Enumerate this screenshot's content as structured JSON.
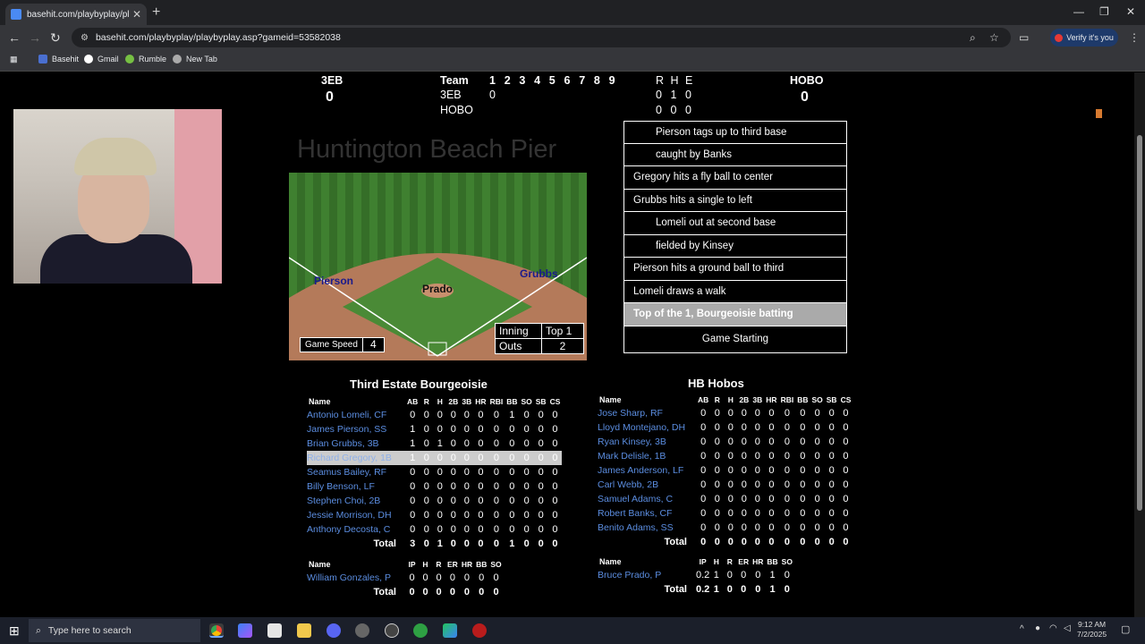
{
  "browser": {
    "tab_title": "basehit.com/playbyplay/playbyp",
    "url": "basehit.com/playbyplay/playbyplay.asp?gameid=53582038",
    "verify_label": "Verify it's you",
    "bookmarks": [
      "Basehit",
      "Gmail",
      "Rumble",
      "New Tab"
    ]
  },
  "scoreboard": {
    "away_abbr": "3EB",
    "away_score": "0",
    "home_abbr": "HOBO",
    "home_score": "0",
    "team_header": "Team",
    "innings": [
      "1",
      "2",
      "3",
      "4",
      "5",
      "6",
      "7",
      "8",
      "9"
    ],
    "rhe_header": [
      "R",
      "H",
      "E"
    ],
    "away_line": {
      "team": "3EB",
      "innings": [
        "0",
        "",
        "",
        "",
        "",
        "",
        "",
        "",
        ""
      ],
      "rhe": [
        "0",
        "1",
        "0"
      ]
    },
    "home_line": {
      "team": "HOBO",
      "innings": [
        "",
        "",
        "",
        "",
        "",
        "",
        "",
        "",
        ""
      ],
      "rhe": [
        "0",
        "0",
        "0"
      ]
    }
  },
  "stadium": "Huntington Beach Pier",
  "field": {
    "players": {
      "left": "Pierson",
      "pitcher": "Prado",
      "right": "Grubbs"
    },
    "game_speed_label": "Game Speed",
    "game_speed_value": "4",
    "inning_label": "Inning",
    "inning_value": "Top 1",
    "outs_label": "Outs",
    "outs_value": "2"
  },
  "play_by_play": [
    {
      "text": "Pierson tags up to third base",
      "style": "indent"
    },
    {
      "text": "caught by Banks",
      "style": "indent"
    },
    {
      "text": "Gregory hits a fly ball to center",
      "style": ""
    },
    {
      "text": "Grubbs hits a single to left",
      "style": ""
    },
    {
      "text": "Lomeli out at second base",
      "style": "indent"
    },
    {
      "text": "fielded by Kinsey",
      "style": "indent"
    },
    {
      "text": "Pierson hits a ground ball to third",
      "style": ""
    },
    {
      "text": "Lomeli draws a walk",
      "style": ""
    },
    {
      "text": "Top of the 1, Bourgeoisie batting",
      "style": "hl"
    },
    {
      "text": "Game Starting",
      "style": "center"
    }
  ],
  "away_box": {
    "title": "Third Estate Bourgeoisie",
    "headers": [
      "Name",
      "AB",
      "R",
      "H",
      "2B",
      "3B",
      "HR",
      "RBI",
      "BB",
      "SO",
      "SB",
      "CS"
    ],
    "rows": [
      [
        "Antonio Lomeli, CF",
        "0",
        "0",
        "0",
        "0",
        "0",
        "0",
        "0",
        "1",
        "0",
        "0",
        "0"
      ],
      [
        "James Pierson, SS",
        "1",
        "0",
        "0",
        "0",
        "0",
        "0",
        "0",
        "0",
        "0",
        "0",
        "0"
      ],
      [
        "Brian Grubbs, 3B",
        "1",
        "0",
        "1",
        "0",
        "0",
        "0",
        "0",
        "0",
        "0",
        "0",
        "0"
      ],
      [
        "Richard Gregory, 1B",
        "1",
        "0",
        "0",
        "0",
        "0",
        "0",
        "0",
        "0",
        "0",
        "0",
        "0"
      ],
      [
        "Seamus Bailey, RF",
        "0",
        "0",
        "0",
        "0",
        "0",
        "0",
        "0",
        "0",
        "0",
        "0",
        "0"
      ],
      [
        "Billy Benson, LF",
        "0",
        "0",
        "0",
        "0",
        "0",
        "0",
        "0",
        "0",
        "0",
        "0",
        "0"
      ],
      [
        "Stephen Choi, 2B",
        "0",
        "0",
        "0",
        "0",
        "0",
        "0",
        "0",
        "0",
        "0",
        "0",
        "0"
      ],
      [
        "Jessie Morrison, DH",
        "0",
        "0",
        "0",
        "0",
        "0",
        "0",
        "0",
        "0",
        "0",
        "0",
        "0"
      ],
      [
        "Anthony Decosta, C",
        "0",
        "0",
        "0",
        "0",
        "0",
        "0",
        "0",
        "0",
        "0",
        "0",
        "0"
      ]
    ],
    "selected_row": 3,
    "total": [
      "Total",
      "3",
      "0",
      "1",
      "0",
      "0",
      "0",
      "0",
      "1",
      "0",
      "0",
      "0"
    ],
    "pitch_headers": [
      "Name",
      "IP",
      "H",
      "R",
      "ER",
      "HR",
      "BB",
      "SO"
    ],
    "pitch_rows": [
      [
        "William Gonzales, P",
        "0",
        "0",
        "0",
        "0",
        "0",
        "0",
        "0"
      ]
    ],
    "pitch_total": [
      "Total",
      "0",
      "0",
      "0",
      "0",
      "0",
      "0",
      "0"
    ]
  },
  "home_box": {
    "title": "HB Hobos",
    "headers": [
      "Name",
      "AB",
      "R",
      "H",
      "2B",
      "3B",
      "HR",
      "RBI",
      "BB",
      "SO",
      "SB",
      "CS"
    ],
    "rows": [
      [
        "Jose Sharp, RF",
        "0",
        "0",
        "0",
        "0",
        "0",
        "0",
        "0",
        "0",
        "0",
        "0",
        "0"
      ],
      [
        "Lloyd Montejano, DH",
        "0",
        "0",
        "0",
        "0",
        "0",
        "0",
        "0",
        "0",
        "0",
        "0",
        "0"
      ],
      [
        "Ryan Kinsey, 3B",
        "0",
        "0",
        "0",
        "0",
        "0",
        "0",
        "0",
        "0",
        "0",
        "0",
        "0"
      ],
      [
        "Mark Delisle, 1B",
        "0",
        "0",
        "0",
        "0",
        "0",
        "0",
        "0",
        "0",
        "0",
        "0",
        "0"
      ],
      [
        "James Anderson, LF",
        "0",
        "0",
        "0",
        "0",
        "0",
        "0",
        "0",
        "0",
        "0",
        "0",
        "0"
      ],
      [
        "Carl Webb, 2B",
        "0",
        "0",
        "0",
        "0",
        "0",
        "0",
        "0",
        "0",
        "0",
        "0",
        "0"
      ],
      [
        "Samuel Adams, C",
        "0",
        "0",
        "0",
        "0",
        "0",
        "0",
        "0",
        "0",
        "0",
        "0",
        "0"
      ],
      [
        "Robert Banks, CF",
        "0",
        "0",
        "0",
        "0",
        "0",
        "0",
        "0",
        "0",
        "0",
        "0",
        "0"
      ],
      [
        "Benito Adams, SS",
        "0",
        "0",
        "0",
        "0",
        "0",
        "0",
        "0",
        "0",
        "0",
        "0",
        "0"
      ]
    ],
    "total": [
      "Total",
      "0",
      "0",
      "0",
      "0",
      "0",
      "0",
      "0",
      "0",
      "0",
      "0",
      "0"
    ],
    "pitch_headers": [
      "Name",
      "IP",
      "H",
      "R",
      "ER",
      "HR",
      "BB",
      "SO"
    ],
    "pitch_rows": [
      [
        "Bruce Prado, P",
        "0.2",
        "1",
        "0",
        "0",
        "0",
        "1",
        "0"
      ]
    ],
    "pitch_total": [
      "Total",
      "0.2",
      "1",
      "0",
      "0",
      "0",
      "1",
      "0"
    ]
  },
  "taskbar": {
    "search_placeholder": "Type here to search",
    "time": "9:12 AM",
    "date": "7/2/2025"
  }
}
